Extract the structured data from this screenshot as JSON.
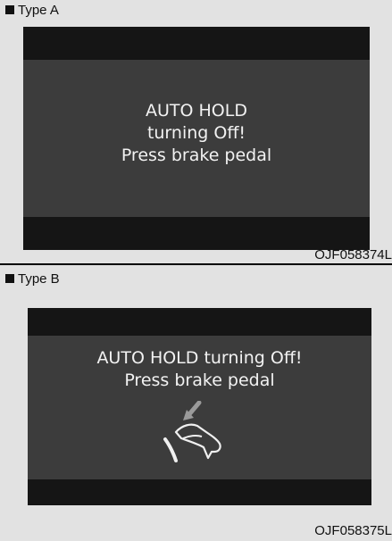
{
  "type_a": {
    "label": "Type A",
    "message_lines": [
      "AUTO HOLD",
      "turning Off!",
      "Press brake pedal"
    ],
    "figure_code": "OJF058374L"
  },
  "type_b": {
    "label": "Type B",
    "message_lines": [
      "AUTO HOLD turning Off!",
      "Press brake pedal"
    ],
    "icon": "brake-pedal-press-icon",
    "figure_code": "OJF058375L"
  }
}
